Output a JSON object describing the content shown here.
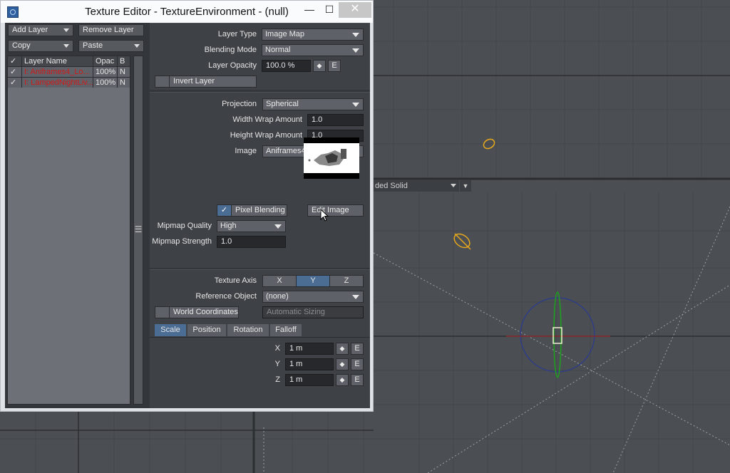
{
  "window": {
    "title": "Texture Editor - TextureEnvironment - (null)",
    "minimize_glyph": "—",
    "maximize_glyph": "☐",
    "close_glyph": "✕"
  },
  "left_pane": {
    "add_layer": "Add Layer",
    "remove_layer": "Remove Layer",
    "copy": "Copy",
    "paste": "Paste",
    "columns": [
      "✓",
      "Layer Name",
      "Opac",
      "B"
    ],
    "layers": [
      {
        "check": "✓",
        "name": "I: Aniframes4_Lo...",
        "opacity": "100%",
        "blend": "N"
      },
      {
        "check": "✓",
        "name": "I: LampedNightLiv...",
        "opacity": "100%",
        "blend": "N"
      }
    ],
    "scroll_grip": "☰"
  },
  "layer_panel": {
    "layer_type_label": "Layer Type",
    "layer_type_value": "Image Map",
    "blending_mode_label": "Blending Mode",
    "blending_mode_value": "Normal",
    "layer_opacity_label": "Layer Opacity",
    "layer_opacity_value": "100.0 %",
    "envelope_button": "E",
    "stepper_glyph": "◆",
    "invert_layer": "Invert Layer"
  },
  "projection_panel": {
    "projection_label": "Projection",
    "projection_value": "Spherical",
    "width_wrap_label": "Width Wrap Amount",
    "width_wrap_value": "1.0",
    "height_wrap_label": "Height Wrap Amount",
    "height_wrap_value": "1.0",
    "image_label": "Image",
    "image_value": "Aniframes4_LowNight_...",
    "pixel_blending": "Pixel Blending",
    "pixel_blending_checked": true,
    "edit_image": "Edit Image",
    "mipmap_quality_label": "Mipmap Quality",
    "mipmap_quality_value": "High",
    "mipmap_strength_label": "Mipmap Strength",
    "mipmap_strength_value": "1.0"
  },
  "axis_panel": {
    "texture_axis_label": "Texture Axis",
    "axes": [
      "X",
      "Y",
      "Z"
    ],
    "selected_axis": "Y",
    "reference_object_label": "Reference Object",
    "reference_object_value": "(none)",
    "world_coordinates": "World Coordinates",
    "automatic_sizing": "Automatic Sizing",
    "tabs": [
      "Scale",
      "Position",
      "Rotation",
      "Falloff"
    ],
    "active_tab": "Scale",
    "scale": [
      {
        "axis": "X",
        "value": "1 m"
      },
      {
        "axis": "Y",
        "value": "1 m"
      },
      {
        "axis": "Z",
        "value": "1 m"
      }
    ]
  },
  "viewport": {
    "shading_mode": "ded Solid"
  },
  "colors": {
    "accent": "#4b6d93",
    "layer_name_red": "#d01a1a",
    "light_gizmo": "#e8a81c"
  }
}
